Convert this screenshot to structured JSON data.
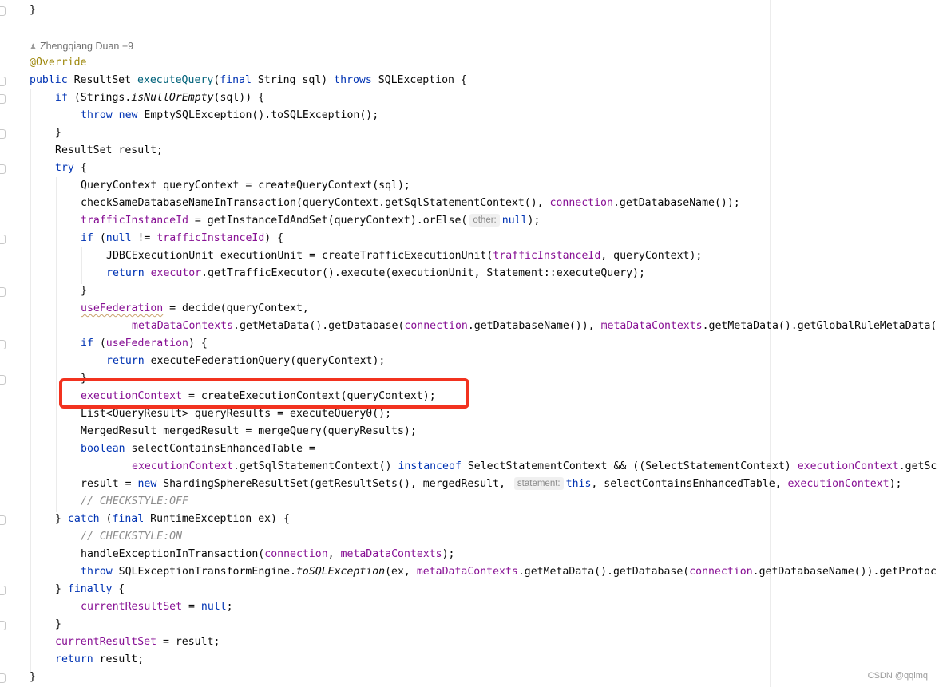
{
  "author": {
    "name": "Zhengqiang Duan +9"
  },
  "code": {
    "l01": "}",
    "l03": "@Override",
    "l04": {
      "a": "public",
      "b": " ResultSet ",
      "c": "executeQuery",
      "d": "(",
      "e": "final",
      "f": " String sql) ",
      "g": "throws",
      "h": " SQLException {"
    },
    "l05": {
      "a": "if",
      "b": " (Strings.",
      "c": "isNullOrEmpty",
      "d": "(sql)) {"
    },
    "l06": {
      "a": "throw new",
      "b": " EmptySQLException().toSQLException();"
    },
    "l07": "}",
    "l08": "ResultSet result;",
    "l09": {
      "a": "try",
      "b": " {"
    },
    "l10": "QueryContext queryContext = createQueryContext(sql);",
    "l11": {
      "a": "checkSameDatabaseNameInTransaction(queryContext.getSqlStatementContext(), ",
      "b": "connection",
      "c": ".getDatabaseName());"
    },
    "l12": {
      "a": "trafficInstanceId",
      "b": " = getInstanceIdAndSet(queryContext).orElse(",
      "hint": "other:",
      "c": "null",
      "d": ");"
    },
    "l13": {
      "a": "if",
      "b": " (",
      "c": "null",
      "d": " != ",
      "e": "trafficInstanceId",
      "f": ") {"
    },
    "l14": {
      "a": "JDBCExecutionUnit executionUnit = createTrafficExecutionUnit(",
      "b": "trafficInstanceId",
      "c": ", queryContext);"
    },
    "l15": {
      "a": "return",
      "b": " ",
      "c": "executor",
      "d": ".getTrafficExecutor().execute(executionUnit, Statement::executeQuery);"
    },
    "l16": "}",
    "l17": {
      "a": "useFederation",
      "b": " = decide(queryContext,"
    },
    "l18": {
      "a": "metaDataContexts",
      "b": ".getMetaData().getDatabase(",
      "c": "connection",
      "d": ".getDatabaseName()), ",
      "e": "metaDataContexts",
      "f": ".getMetaData().getGlobalRuleMetaData("
    },
    "l19": {
      "a": "if",
      "b": " (",
      "c": "useFederation",
      "d": ") {"
    },
    "l20": {
      "a": "return",
      "b": " executeFederationQuery(queryContext);"
    },
    "l21": "}",
    "l22": {
      "a": "executionContext",
      "b": " = createExecutionContext(queryContext);"
    },
    "l23": "List<QueryResult> queryResults = executeQuery0();",
    "l24": "MergedResult mergedResult = mergeQuery(queryResults);",
    "l25": {
      "a": "boolean",
      "b": " selectContainsEnhancedTable ="
    },
    "l26": {
      "a": "executionContext",
      "b": ".getSqlStatementContext() ",
      "c": "instanceof",
      "d": " SelectStatementContext && ((SelectStatementContext) ",
      "e": "executionContext",
      "f": ".getSc"
    },
    "l27": {
      "a": "result = ",
      "b": "new",
      "c": " ShardingSphereResultSet(getResultSets(), mergedResult, ",
      "hint": "statement:",
      "d": "this",
      "e": ", selectContainsEnhancedTable, ",
      "f": "executionContext",
      "g": ");"
    },
    "l28": "// CHECKSTYLE:OFF",
    "l29": {
      "a": "} ",
      "b": "catch",
      "c": " (",
      "d": "final",
      "e": " RuntimeException ex) {"
    },
    "l30": "// CHECKSTYLE:ON",
    "l31": {
      "a": "handleExceptionInTransaction(",
      "b": "connection",
      "c": ", ",
      "d": "metaDataContexts",
      "e": ");"
    },
    "l32": {
      "a": "throw",
      "b": " SQLExceptionTransformEngine.",
      "c": "toSQLException",
      "d": "(ex, ",
      "e": "metaDataContexts",
      "f": ".getMetaData().getDatabase(",
      "g": "connection",
      "h": ".getDatabaseName()).getProtoc"
    },
    "l33": {
      "a": "} ",
      "b": "finally",
      "c": " {"
    },
    "l34": {
      "a": "currentResultSet",
      "b": " = ",
      "c": "null",
      "d": ";"
    },
    "l35": "}",
    "l36": {
      "a": "currentResultSet",
      "b": " = result;"
    },
    "l37": {
      "a": "return",
      "b": " result;"
    },
    "l38": "}"
  },
  "watermark": "CSDN @qqlmq",
  "colors": {
    "keyword": "#0033b3",
    "field": "#871094",
    "method": "#00627a",
    "annotation": "#9e880d",
    "comment": "#8c8c8c",
    "highlight": "#f2321f"
  }
}
